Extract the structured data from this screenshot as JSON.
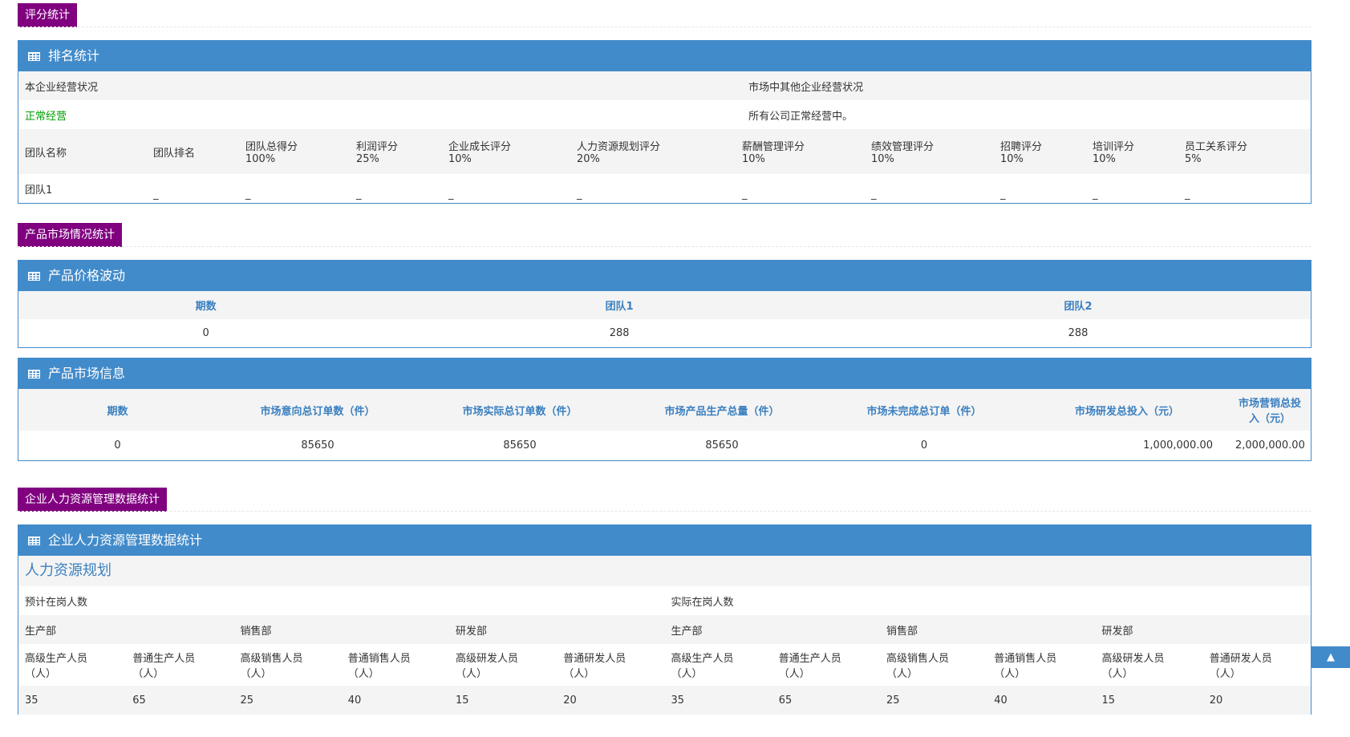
{
  "sections": {
    "score": "评分统计",
    "market": "产品市场情况统计",
    "hr": "企业人力资源管理数据统计"
  },
  "ranking": {
    "title": "排名统计",
    "own_status_label": "本企业经营状况",
    "other_status_label": "市场中其他企业经营状况",
    "own_status": "正常经营",
    "other_status": "所有公司正常经营中。",
    "columns": [
      {
        "name": "团队名称",
        "weight": ""
      },
      {
        "name": "团队排名",
        "weight": ""
      },
      {
        "name": "团队总得分",
        "weight": "100%"
      },
      {
        "name": "利润评分",
        "weight": "25%"
      },
      {
        "name": "企业成长评分",
        "weight": "10%"
      },
      {
        "name": "人力资源规划评分",
        "weight": "20%"
      },
      {
        "name": "薪酬管理评分",
        "weight": "10%"
      },
      {
        "name": "绩效管理评分",
        "weight": "10%"
      },
      {
        "name": "招聘评分",
        "weight": "10%"
      },
      {
        "name": "培训评分",
        "weight": "10%"
      },
      {
        "name": "员工关系评分",
        "weight": "5%"
      }
    ],
    "row": [
      "团队1",
      "_",
      "_",
      "_",
      "_",
      "_",
      "_",
      "_",
      "_",
      "_",
      "_"
    ]
  },
  "price": {
    "title": "产品价格波动",
    "headers": [
      "期数",
      "团队1",
      "团队2"
    ],
    "row": [
      "0",
      "288",
      "288"
    ]
  },
  "market_info": {
    "title": "产品市场信息",
    "headers": [
      "期数",
      "市场意向总订单数（件）",
      "市场实际总订单数（件）",
      "市场产品生产总量（件）",
      "市场未完成总订单（件）",
      "市场研发总投入（元）",
      "市场营销总投入（元）"
    ],
    "row": [
      "0",
      "85650",
      "85650",
      "85650",
      "0",
      "1,000,000.00",
      "2,000,000.00"
    ]
  },
  "hr": {
    "title": "企业人力资源管理数据统计",
    "subtitle": "人力资源规划",
    "expected_label": "预计在岗人数",
    "actual_label": "实际在岗人数",
    "departments": [
      "生产部",
      "销售部",
      "研发部",
      "生产部",
      "销售部",
      "研发部"
    ],
    "roles": [
      {
        "name": "高级生产人员",
        "unit": "（人）"
      },
      {
        "name": "普通生产人员",
        "unit": "（人）"
      },
      {
        "name": "高级销售人员",
        "unit": "（人）"
      },
      {
        "name": "普通销售人员",
        "unit": "（人）"
      },
      {
        "name": "高级研发人员",
        "unit": "（人）"
      },
      {
        "name": "普通研发人员",
        "unit": "（人）"
      },
      {
        "name": "高级生产人员",
        "unit": "（人）"
      },
      {
        "name": "普通生产人员",
        "unit": "（人）"
      },
      {
        "name": "高级销售人员",
        "unit": "（人）"
      },
      {
        "name": "普通销售人员",
        "unit": "（人）"
      },
      {
        "name": "高级研发人员",
        "unit": "（人）"
      },
      {
        "name": "普通研发人员",
        "unit": "（人）"
      }
    ],
    "values": [
      "35",
      "65",
      "25",
      "40",
      "15",
      "20",
      "35",
      "65",
      "25",
      "40",
      "15",
      "20"
    ]
  },
  "back_to_top": "▲"
}
